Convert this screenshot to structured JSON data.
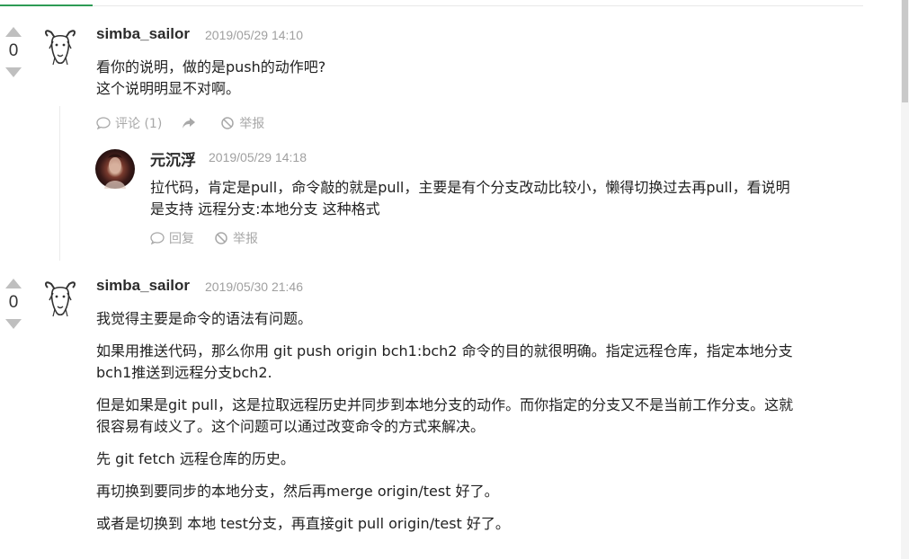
{
  "comments": [
    {
      "votes": "0",
      "author": "simba_sailor",
      "date": "2019/05/29 14:10",
      "text_lines": [
        "看你的说明，做的是push的动作吧?",
        "这个说明明显不对啊。"
      ],
      "actions": {
        "comment": "评论 (1)",
        "report": "举报"
      },
      "reply": {
        "author": "元沉浮",
        "date": "2019/05/29 14:18",
        "text_lines": [
          "拉代码，肯定是pull，命令敲的就是pull，主要是有个分支改动比较小，懒得切换过去再pull，看说明",
          "是支持 远程分支:本地分支 这种格式"
        ],
        "actions": {
          "reply": "回复",
          "report": "举报"
        }
      }
    },
    {
      "votes": "0",
      "author": "simba_sailor",
      "date": "2019/05/30 21:46",
      "paragraphs": [
        [
          "我觉得主要是命令的语法有问题。"
        ],
        [
          "如果用推送代码，那么你用 git push origin bch1:bch2  命令的目的就很明确。指定远程仓库，指定本地分支",
          "bch1推送到远程分支bch2."
        ],
        [
          "但是如果是git pull，这是拉取远程历史并同步到本地分支的动作。而你指定的分支又不是当前工作分支。这就",
          "很容易有歧义了。这个问题可以通过改变命令的方式来解决。"
        ],
        [
          "先 git fetch 远程仓库的历史。"
        ],
        [
          "再切换到要同步的本地分支，然后再merge origin/test 好了。"
        ],
        [
          "或者是切换到 本地 test分支，再直接git pull origin/test 好了。"
        ]
      ]
    }
  ]
}
